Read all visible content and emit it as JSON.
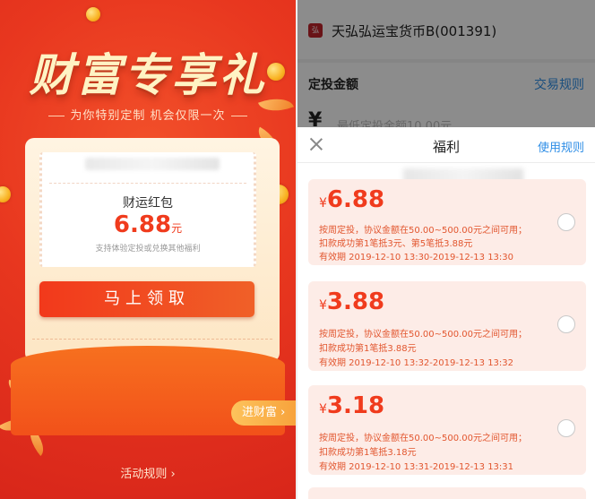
{
  "left": {
    "title": "财富专享礼",
    "subtitle": "为你特别定制 机会仅限一次",
    "coupon": {
      "name": "财运红包",
      "amount": "6.88",
      "unit": "元",
      "note": "支持体验定投或兑换其他福利"
    },
    "claim_button": "马上领取",
    "enter_button": "进财富 ›",
    "rules_link": "活动规则 ›"
  },
  "right": {
    "fund_logo": "弘",
    "fund_name": "天弘弘运宝货币B(001391)",
    "amount_label": "定投金额",
    "trade_rules": "交易规则",
    "yen": "¥",
    "amount_placeholder": "最低定投金额10.00元",
    "sheet": {
      "title": "福利",
      "usage_rules": "使用规则",
      "coupons": [
        {
          "symbol": "¥",
          "value": "6.88",
          "line1": "按周定投，协议金额在50.00~500.00元之间可用；",
          "line2": "扣款成功第1笔抵3元、第5笔抵3.88元",
          "line3": "有效期 2019-12-10 13:30-2019-12-13 13:30"
        },
        {
          "symbol": "¥",
          "value": "3.88",
          "line1": "按周定投，协议金额在50.00~500.00元之间可用；",
          "line2": "扣款成功第1笔抵3.88元",
          "line3": "有效期 2019-12-10 13:32-2019-12-13 13:32"
        },
        {
          "symbol": "¥",
          "value": "3.18",
          "line1": "按周定投，协议金额在50.00~500.00元之间可用；",
          "line2": "扣款成功第1笔抵3.18元",
          "line3": "有效期 2019-12-10 13:31-2019-12-13 13:31"
        }
      ]
    }
  },
  "colors": {
    "primary_red": "#f03b1d",
    "link_blue": "#2f8ee6",
    "coupon_bg": "#fdece7"
  }
}
